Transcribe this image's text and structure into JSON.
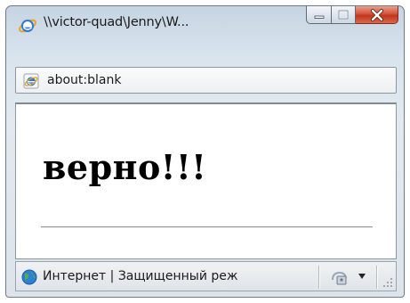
{
  "window": {
    "title": "\\\\victor-quad\\Jenny\\W...",
    "minimize_label": "",
    "maximize_label": "",
    "close_label": "",
    "icons": {
      "app": "ie-icon",
      "min": "minimize-icon",
      "max": "maximize-icon",
      "close": "close-icon"
    }
  },
  "addressbar": {
    "url": "about:blank",
    "icon": "ie-page-icon"
  },
  "content": {
    "heading": "верно!!!"
  },
  "statusbar": {
    "zone_text": "Интернет | Защищенный реж",
    "icons": {
      "zone": "globe-icon",
      "security": "security-zone-icon",
      "dropdown": "chevron-down-icon",
      "grip": "resize-grip-icon"
    }
  },
  "colors": {
    "close_button": "#c9442a",
    "frame": "#d9e4ee",
    "heading": "#000000"
  }
}
